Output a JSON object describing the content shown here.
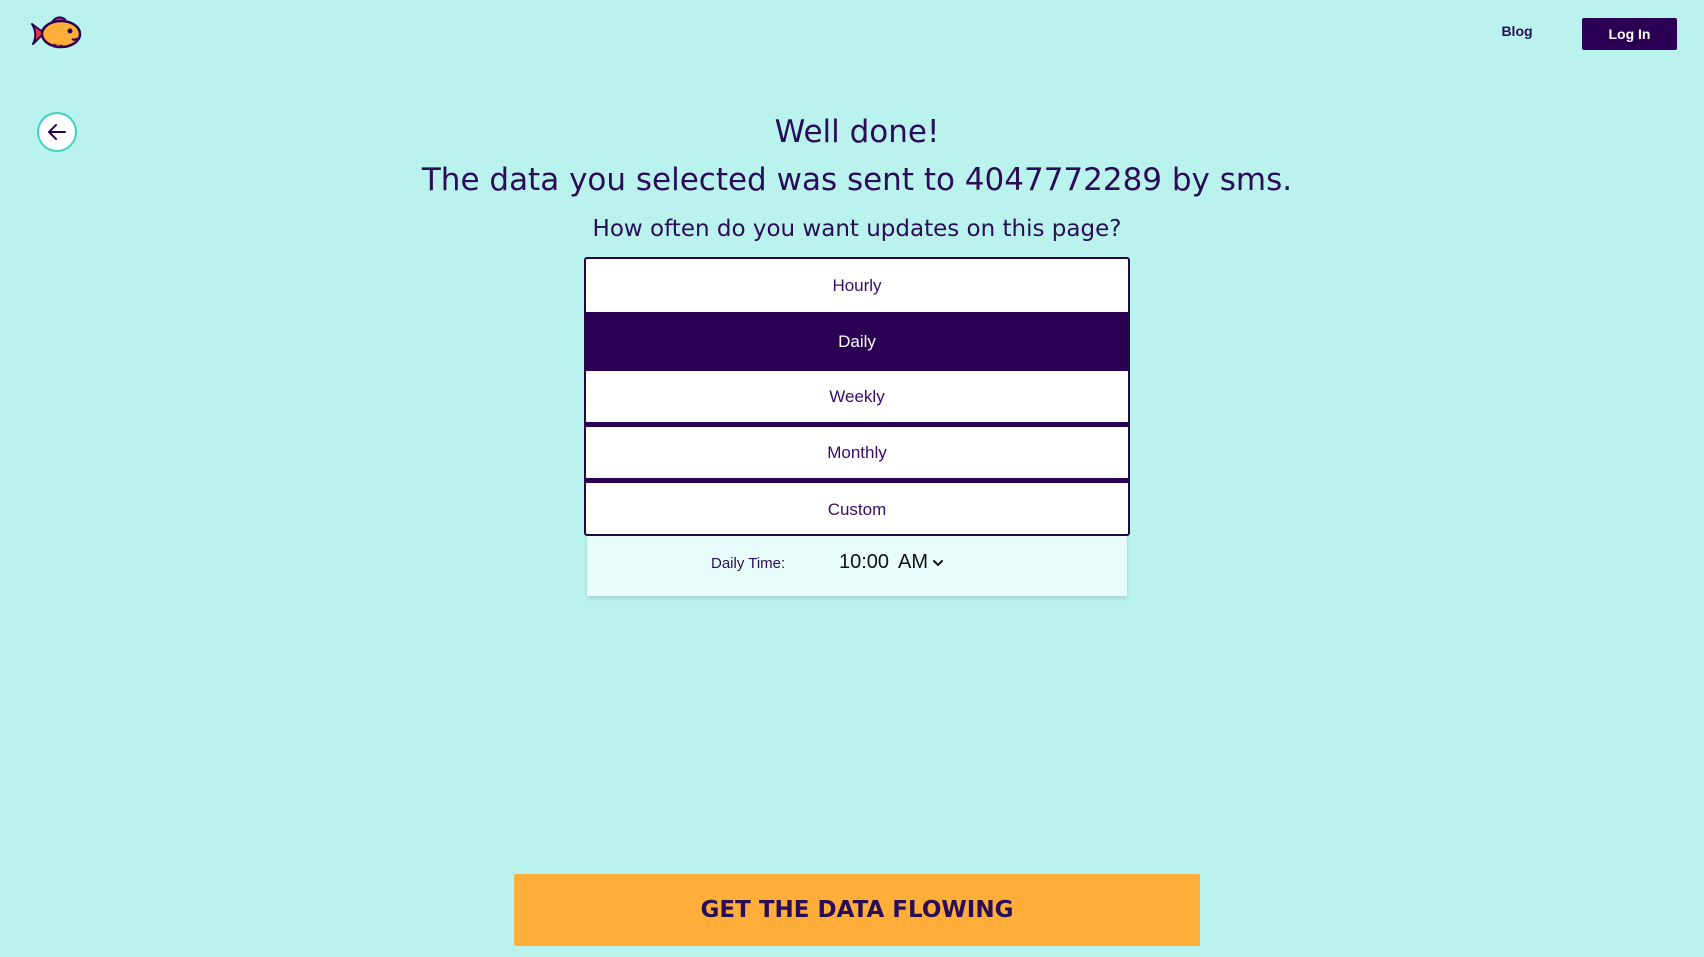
{
  "header": {
    "logo_icon": "goldfish-logo-icon",
    "blog_label": "Blog",
    "login_label": "Log In"
  },
  "back_icon": "arrow-left-icon",
  "main": {
    "title": "Well done!",
    "sent_message": "The data you selected was sent to 4047772289 by sms.",
    "question": "How often do you want updates on this page?"
  },
  "frequency": {
    "options": [
      "Hourly",
      "Daily",
      "Weekly",
      "Monthly",
      "Custom"
    ],
    "selected": "Daily"
  },
  "time": {
    "label": "Daily Time:",
    "value": "10:00",
    "period": "AM",
    "chevron_icon": "chevron-down-icon"
  },
  "cta_label": "GET THE DATA FLOWING",
  "colors": {
    "background": "#baf3ee",
    "primary": "#2b0054",
    "accent": "#ffae3a",
    "text": "#2b0c57"
  }
}
